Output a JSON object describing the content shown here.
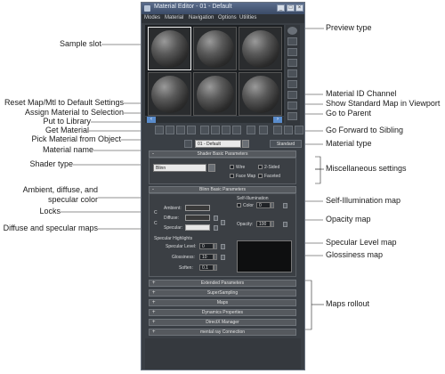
{
  "window": {
    "title": "Material Editor - 01 - Default",
    "menus": [
      "Modes",
      "Material",
      "Navigation",
      "Options",
      "Utilities"
    ]
  },
  "material": {
    "name": "01 - Default",
    "type_button": "Standard",
    "shader": "Blinn"
  },
  "rollouts": {
    "shader_basic": "Shader Basic Parameters",
    "blinn_basic": "Blinn Basic Parameters",
    "extended": "Extended Parameters",
    "supersampling": "SuperSampling",
    "maps": "Maps",
    "dynamics": "Dynamics Properties",
    "directx": "DirectX Manager",
    "mental_ray": "mental ray Connection"
  },
  "shader_options": {
    "wire": "Wire",
    "two_sided": "2-Sided",
    "face_map": "Face Map",
    "faceted": "Faceted"
  },
  "blinn": {
    "self_illum_group": "Self-Illumination",
    "color_label": "Color",
    "color_value": "0",
    "opacity_label": "Opacity:",
    "opacity_value": "100",
    "ambient": "Ambient:",
    "diffuse": "Diffuse:",
    "specular": "Specular:",
    "lock_symbol": "C",
    "highlights_group": "Specular Highlights",
    "spec_level_label": "Specular Level:",
    "spec_level_value": "0",
    "glossiness_label": "Glossiness:",
    "glossiness_value": "10",
    "soften_label": "Soften:",
    "soften_value": "0.1"
  },
  "annotations": {
    "sample_slot": "Sample slot",
    "reset_map": "Reset Map/Mtl to Default Settings",
    "assign_material": "Assign Material to Selection",
    "put_library": "Put to Library",
    "get_material": "Get Material",
    "pick_material": "Pick Material from Object",
    "material_name": "Material name",
    "shader_type": "Shader type",
    "amb_diff_spec": "Ambient, diffuse, and specular color",
    "locks": "Locks",
    "diffuse_spec_maps": "Diffuse and specular maps",
    "preview_type": "Preview type",
    "material_id": "Material ID Channel",
    "show_std_map": "Show Standard Map in Viewport",
    "go_parent": "Go to Parent",
    "go_forward": "Go Forward to Sibling",
    "material_type": "Material type",
    "misc_settings": "Miscellaneous settings",
    "self_illum_map": "Self-Illumination map",
    "opacity_map": "Opacity map",
    "spec_level_map": "Specular Level map",
    "glossiness_map": "Glossiness map",
    "maps_rollout": "Maps rollout"
  },
  "colors": {
    "window_bg": "#3a3f45",
    "titlebar": "#4a5a78",
    "accent_blue": "#5a8ccc"
  }
}
